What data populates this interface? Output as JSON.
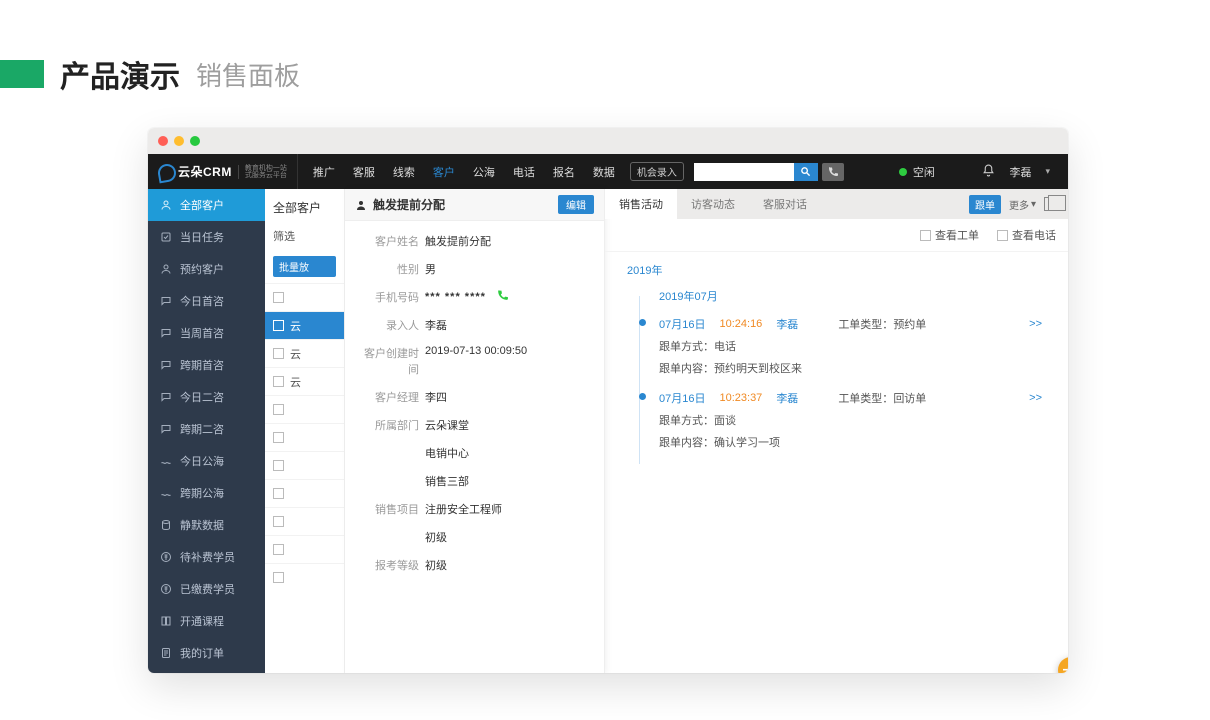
{
  "page": {
    "title": "产品演示",
    "subtitle": "销售面板"
  },
  "logo": {
    "brand": "云朵CRM",
    "tag1": "教育机构一站",
    "tag2": "式服务云平台"
  },
  "topnav": {
    "items": [
      "推广",
      "客服",
      "线索",
      "客户",
      "公海",
      "电话",
      "报名",
      "数据"
    ],
    "active_index": 3,
    "extra": "机会录入"
  },
  "status": {
    "label": "空闲"
  },
  "user": {
    "name": "李磊"
  },
  "sidebar": {
    "items": [
      {
        "label": "全部客户",
        "icon": "user"
      },
      {
        "label": "当日任务",
        "icon": "check"
      },
      {
        "label": "预约客户",
        "icon": "person"
      },
      {
        "label": "今日首咨",
        "icon": "chat"
      },
      {
        "label": "当周首咨",
        "icon": "chat"
      },
      {
        "label": "跨期首咨",
        "icon": "chat"
      },
      {
        "label": "今日二咨",
        "icon": "chat"
      },
      {
        "label": "跨期二咨",
        "icon": "chat"
      },
      {
        "label": "今日公海",
        "icon": "sea"
      },
      {
        "label": "跨期公海",
        "icon": "sea"
      },
      {
        "label": "静默数据",
        "icon": "db"
      },
      {
        "label": "待补费学员",
        "icon": "money"
      },
      {
        "label": "已缴费学员",
        "icon": "money"
      },
      {
        "label": "开通课程",
        "icon": "book"
      },
      {
        "label": "我的订单",
        "icon": "order"
      }
    ],
    "active_index": 0
  },
  "list": {
    "title": "全部客户",
    "filter_label": "筛选",
    "bulk_button": "批量放",
    "rows": [
      "",
      "云",
      "云",
      "云",
      "",
      "",
      "",
      "",
      "",
      "",
      ""
    ]
  },
  "detail": {
    "title": "触发提前分配",
    "edit": "编辑",
    "fields": {
      "name_label": "客户姓名",
      "name": "触发提前分配",
      "gender_label": "性别",
      "gender": "男",
      "phone_label": "手机号码",
      "phone": "*** *** ****",
      "entry_label": "录入人",
      "entry": "李磊",
      "created_label": "客户创建时间",
      "created": "2019-07-13 00:09:50",
      "manager_label": "客户经理",
      "manager": "李四",
      "dept_label": "所属部门",
      "dept": "云朵课堂",
      "dept2": "电销中心",
      "dept3": "销售三部",
      "project_label": "销售项目",
      "project": "注册安全工程师",
      "level": "初级",
      "exam_label": "报考等级",
      "exam": "初级"
    }
  },
  "tabs": {
    "items": [
      "销售活动",
      "访客动态",
      "客服对话"
    ],
    "active_index": 0,
    "pill": "跟单",
    "more": "更多"
  },
  "toolbar": {
    "ticket": "查看工单",
    "call": "查看电话"
  },
  "timeline": {
    "year": "2019年",
    "month": "2019年07月",
    "entries": [
      {
        "date": "07月16日",
        "time": "10:24:16",
        "user": "李磊",
        "type_label": "工单类型：",
        "type": "预约单",
        "f1_label": "跟单方式：",
        "f1": "电话",
        "f2_label": "跟单内容：",
        "f2": "预约明天到校区来",
        "expand": ">>"
      },
      {
        "date": "07月16日",
        "time": "10:23:37",
        "user": "李磊",
        "type_label": "工单类型：",
        "type": "回访单",
        "f1_label": "跟单方式：",
        "f1": "面谈",
        "f2_label": "跟单内容：",
        "f2": "确认学习一项",
        "expand": ">>"
      }
    ]
  }
}
